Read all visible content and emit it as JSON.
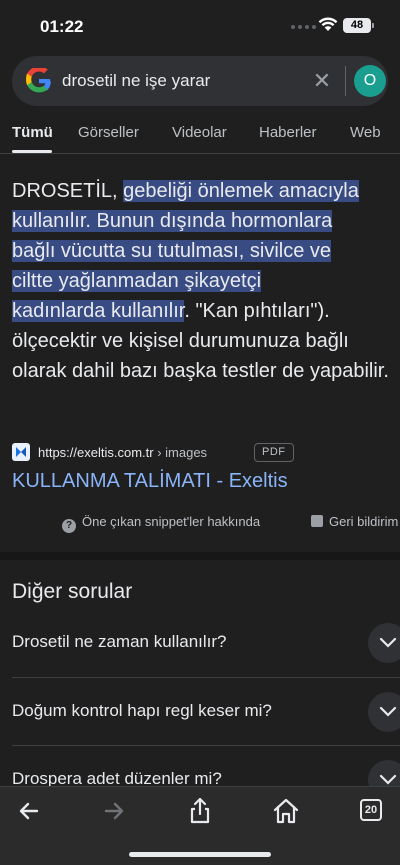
{
  "status_bar": {
    "time": "01:22",
    "battery": "48"
  },
  "search": {
    "query": "drosetil ne işe yarar",
    "avatar_letter": "O"
  },
  "tabs": [
    {
      "label": "Tümü",
      "active": true
    },
    {
      "label": "Görseller"
    },
    {
      "label": "Videolar"
    },
    {
      "label": "Haberler"
    },
    {
      "label": "Web"
    }
  ],
  "snippet": {
    "lead": "DROSETİL, ",
    "hl1": "gebeliği önlemek amacıyla",
    "hl2": "kullanılır. Bunun dışında hormonlara",
    "hl3": "bağlı vücutta su tutulması, sivilce ve",
    "hl4": "ciltte yağlanmadan şikayetçi",
    "hl5": "kadınlarda kullanılır",
    "tail": ". \"Kan pıhtıları\"). ölçecektir ve kişisel durumunuza bağlı olarak dahil bazı başka testler de yapabilir."
  },
  "source": {
    "domain": "https://exeltis.com.tr",
    "path": " › images",
    "badge": "PDF",
    "title": "KULLANMA TALİMATI - Exeltis"
  },
  "feedback": {
    "about": "Öne çıkan snippet'ler hakkında",
    "report": "Geri bildirim"
  },
  "other_questions": {
    "title": "Diğer sorular",
    "items": [
      "Drosetil ne zaman kullanılır?",
      "Doğum kontrol hapı regl keser mi?",
      "Drospera adet düzenler mi?"
    ]
  },
  "bottom_nav": {
    "tab_count": "20"
  },
  "colors": {
    "background": "#1f1f1f",
    "highlight": "#394b83",
    "link": "#8ab4f8",
    "avatar": "#1a9e8f"
  }
}
